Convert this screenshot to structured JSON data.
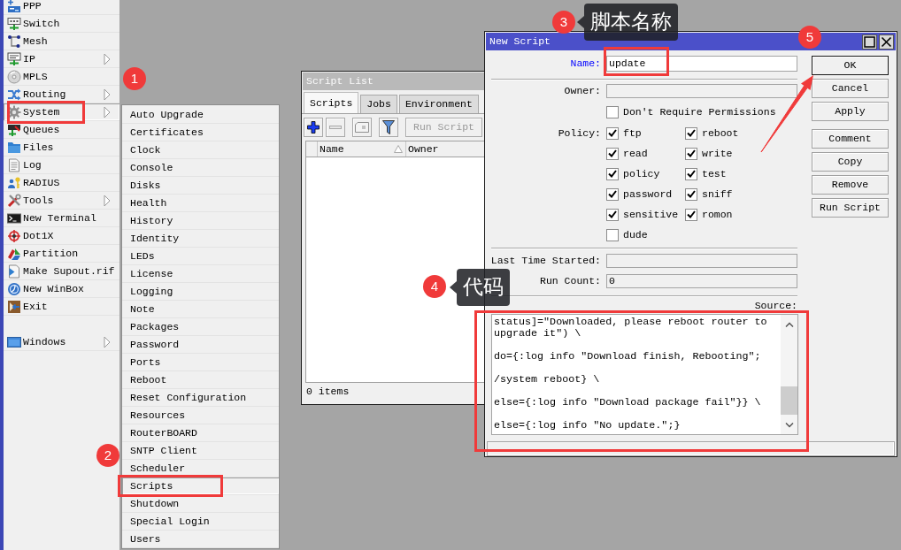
{
  "sidebar": {
    "sections": [
      {
        "items": [
          {
            "label": "PPP",
            "submenu": false,
            "selected": false
          },
          {
            "label": "Switch",
            "submenu": false,
            "selected": false
          },
          {
            "label": "Mesh",
            "submenu": false,
            "selected": false
          },
          {
            "label": "IP",
            "submenu": true,
            "selected": false
          },
          {
            "label": "MPLS",
            "submenu": false,
            "selected": false
          },
          {
            "label": "Routing",
            "submenu": true,
            "selected": false
          },
          {
            "label": "System",
            "submenu": true,
            "selected": true
          },
          {
            "label": "Queues",
            "submenu": false,
            "selected": false
          },
          {
            "label": "Files",
            "submenu": false,
            "selected": false
          },
          {
            "label": "Log",
            "submenu": false,
            "selected": false
          },
          {
            "label": "RADIUS",
            "submenu": false,
            "selected": false
          },
          {
            "label": "Tools",
            "submenu": true,
            "selected": false
          },
          {
            "label": "New Terminal",
            "submenu": false,
            "selected": false
          },
          {
            "label": "Dot1X",
            "submenu": false,
            "selected": false
          },
          {
            "label": "Partition",
            "submenu": false,
            "selected": false
          },
          {
            "label": "Make Supout.rif",
            "submenu": false,
            "selected": false
          },
          {
            "label": "New WinBox",
            "submenu": false,
            "selected": false
          },
          {
            "label": "Exit",
            "submenu": false,
            "selected": false
          }
        ]
      },
      {
        "items": [
          {
            "label": "Windows",
            "submenu": true,
            "selected": false
          }
        ]
      }
    ]
  },
  "submenu": {
    "items": [
      {
        "label": "Auto Upgrade",
        "selected": false
      },
      {
        "label": "Certificates",
        "selected": false
      },
      {
        "label": "Clock",
        "selected": false
      },
      {
        "label": "Console",
        "selected": false
      },
      {
        "label": "Disks",
        "selected": false
      },
      {
        "label": "Health",
        "selected": false
      },
      {
        "label": "History",
        "selected": false
      },
      {
        "label": "Identity",
        "selected": false
      },
      {
        "label": "LEDs",
        "selected": false
      },
      {
        "label": "License",
        "selected": false
      },
      {
        "label": "Logging",
        "selected": false
      },
      {
        "label": "Note",
        "selected": false
      },
      {
        "label": "Packages",
        "selected": false
      },
      {
        "label": "Password",
        "selected": false
      },
      {
        "label": "Ports",
        "selected": false
      },
      {
        "label": "Reboot",
        "selected": false
      },
      {
        "label": "Reset Configuration",
        "selected": false
      },
      {
        "label": "Resources",
        "selected": false
      },
      {
        "label": "RouterBOARD",
        "selected": false
      },
      {
        "label": "SNTP Client",
        "selected": false
      },
      {
        "label": "Scheduler",
        "selected": false
      },
      {
        "label": "Scripts",
        "selected": true
      },
      {
        "label": "Shutdown",
        "selected": false
      },
      {
        "label": "Special Login",
        "selected": false
      },
      {
        "label": "Users",
        "selected": false
      }
    ]
  },
  "script_list": {
    "title": "Script List",
    "active": false,
    "tabs": [
      {
        "label": "Scripts",
        "selected": true
      },
      {
        "label": "Jobs",
        "selected": false
      },
      {
        "label": "Environment",
        "selected": false
      }
    ],
    "run_button": {
      "label": "Run Script",
      "disabled": true
    },
    "columns": [
      {
        "label": "Name",
        "sorted": true
      },
      {
        "label": "Owner",
        "sorted": false
      }
    ],
    "status": "0 items"
  },
  "new_script": {
    "title": "New Script",
    "active": true,
    "name": {
      "label": "Name:",
      "value": "update",
      "required": true,
      "disabled": false
    },
    "owner": {
      "label": "Owner:",
      "required": false,
      "disabled": true
    },
    "dont_require_permissions": {
      "label": "Don't Require Permissions",
      "checked": false
    },
    "policy": {
      "label": "Policy:",
      "options": [
        {
          "label": "ftp",
          "checked": true
        },
        {
          "label": "reboot",
          "checked": true
        },
        {
          "label": "read",
          "checked": true
        },
        {
          "label": "write",
          "checked": true
        },
        {
          "label": "policy",
          "checked": true
        },
        {
          "label": "test",
          "checked": true
        },
        {
          "label": "password",
          "checked": true
        },
        {
          "label": "sniff",
          "checked": true
        },
        {
          "label": "sensitive",
          "checked": true
        },
        {
          "label": "romon",
          "checked": true
        },
        {
          "label": "dude",
          "checked": false
        }
      ]
    },
    "last_time_started": {
      "label": "Last Time Started:",
      "required": false,
      "disabled": true
    },
    "run_count": {
      "label": "Run Count:",
      "value": "0",
      "required": false,
      "disabled": true
    },
    "source": {
      "label": "Source:",
      "value": "status]=\"Downloaded, please reboot router to upgrade it\") \\\n\ndo={:log info \"Download finish, Rebooting\";\n\n/system reboot} \\\n\nelse={:log info \"Download package fail\"}} \\\n\nelse={:log info \"No update.\";}"
    },
    "button_groups": [
      [
        {
          "label": "OK",
          "default": true
        },
        {
          "label": "Cancel",
          "default": false
        },
        {
          "label": "Apply",
          "default": false
        }
      ],
      [
        {
          "label": "Comment",
          "default": false
        },
        {
          "label": "Copy",
          "default": false
        },
        {
          "label": "Remove",
          "default": false
        },
        {
          "label": "Run Script",
          "default": false
        }
      ]
    ]
  },
  "annotations": {
    "steps": [
      "1",
      "2",
      "3",
      "4",
      "5"
    ],
    "callouts": [
      "脚本名称",
      "代码"
    ]
  }
}
